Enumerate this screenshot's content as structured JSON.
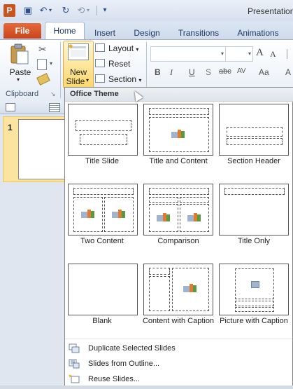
{
  "window": {
    "title": "Presentation"
  },
  "tabs": [
    {
      "label": "File"
    },
    {
      "label": "Home"
    },
    {
      "label": "Insert"
    },
    {
      "label": "Design"
    },
    {
      "label": "Transitions"
    },
    {
      "label": "Animations"
    }
  ],
  "ribbon": {
    "clipboard": {
      "paste_label": "Paste",
      "group_label": "Clipboard"
    },
    "slides": {
      "new_slide_line1": "New",
      "new_slide_line2": "Slide",
      "layout_label": "Layout",
      "reset_label": "Reset",
      "section_label": "Section"
    },
    "font": {
      "grow_label": "A",
      "shrink_label": "A",
      "bold": "B",
      "italic": "I",
      "underline": "U",
      "shadow": "S",
      "strike": "abc",
      "spacing": "AV",
      "case": "Aa",
      "color": "A"
    }
  },
  "slide_pane": {
    "slide_number": "1"
  },
  "gallery": {
    "title": "Office Theme",
    "layouts": [
      {
        "label": "Title Slide"
      },
      {
        "label": "Title and Content"
      },
      {
        "label": "Section Header"
      },
      {
        "label": "Two Content"
      },
      {
        "label": "Comparison"
      },
      {
        "label": "Title Only"
      },
      {
        "label": "Blank"
      },
      {
        "label": "Content with Caption"
      },
      {
        "label": "Picture with Caption"
      }
    ],
    "menu": [
      {
        "label": "Duplicate Selected Slides"
      },
      {
        "label": "Slides from Outline..."
      },
      {
        "label": "Reuse Slides..."
      }
    ]
  },
  "colors": {
    "file_tab": "#c8441b",
    "accent_highlight": "#fbd86b",
    "selected_slide": "#fbe3a0"
  }
}
